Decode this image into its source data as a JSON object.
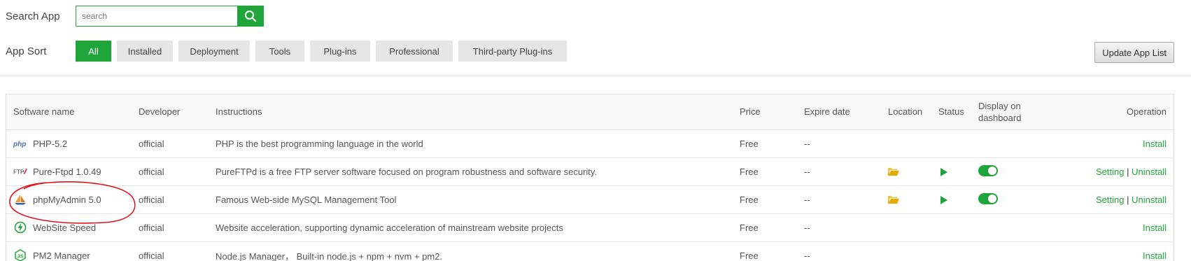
{
  "search": {
    "label": "Search App",
    "placeholder": "search"
  },
  "sort": {
    "label": "App Sort",
    "tabs": [
      "All",
      "Installed",
      "Deployment",
      "Tools",
      "Plug-ins",
      "Professional",
      "Third-party Plug-ins"
    ],
    "active": "All"
  },
  "update_button": "Update App List",
  "table": {
    "headers": {
      "name": "Software name",
      "developer": "Developer",
      "instructions": "Instructions",
      "price": "Price",
      "expire": "Expire date",
      "location": "Location",
      "status": "Status",
      "display_line1": "Display on",
      "display_line2": "dashboard",
      "operation": "Operation"
    },
    "rows": [
      {
        "icon": "php-icon",
        "name": "PHP-5.2",
        "developer": "official",
        "instructions": "PHP is the best programming language in the world",
        "price": "Free",
        "expire": "--",
        "installed": false,
        "install": "Install"
      },
      {
        "icon": "ftp-icon",
        "name": "Pure-Ftpd 1.0.49",
        "developer": "official",
        "instructions": "PureFTPd is a free FTP server software focused on program robustness and software security.",
        "price": "Free",
        "expire": "--",
        "installed": true,
        "setting": "Setting",
        "separator": "|",
        "uninstall": "Uninstall"
      },
      {
        "icon": "phpmyadmin-icon",
        "name": "phpMyAdmin 5.0",
        "developer": "official",
        "instructions": "Famous Web-side MySQL Management Tool",
        "price": "Free",
        "expire": "--",
        "installed": true,
        "setting": "Setting",
        "separator": "|",
        "uninstall": "Uninstall"
      },
      {
        "icon": "lightning-icon",
        "name": "WebSite Speed",
        "developer": "official",
        "instructions": "Website acceleration, supporting dynamic acceleration of mainstream website projects",
        "price": "Free",
        "expire": "--",
        "installed": false,
        "install": "Install"
      },
      {
        "icon": "nodejs-icon",
        "name": "PM2 Manager",
        "developer": "official",
        "instructions": "Node.js Manager， Built-in node.js + npm + nvm + pm2.",
        "price": "Free",
        "expire": "--",
        "installed": false,
        "install": "Install"
      }
    ]
  },
  "colors": {
    "accent": "#20a53a",
    "annotation": "#e0121b",
    "folder": "#f5b700"
  }
}
